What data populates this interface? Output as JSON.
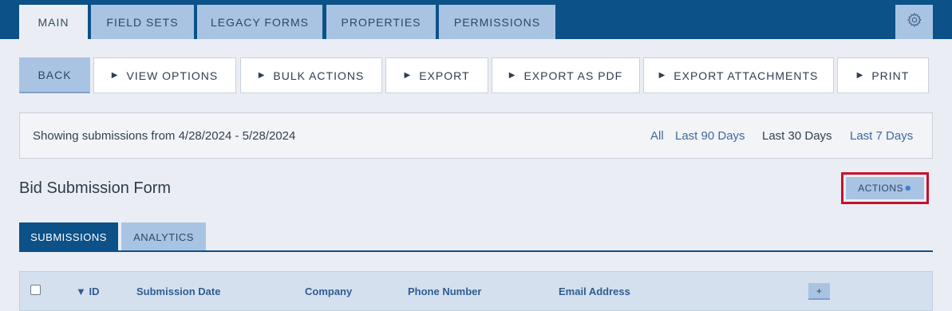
{
  "top_tabs": [
    {
      "label": "MAIN",
      "active": true
    },
    {
      "label": "FIELD SETS",
      "active": false
    },
    {
      "label": "LEGACY FORMS",
      "active": false
    },
    {
      "label": "PROPERTIES",
      "active": false
    },
    {
      "label": "PERMISSIONS",
      "active": false
    }
  ],
  "settings_icon": "gear-icon",
  "toolbar": {
    "back": "BACK",
    "view_options": "VIEW OPTIONS",
    "bulk_actions": "BULK ACTIONS",
    "export": "EXPORT",
    "export_pdf": "EXPORT AS PDF",
    "export_attachments": "EXPORT ATTACHMENTS",
    "print": "PRINT",
    "expand_icon": "triangle-right-icon"
  },
  "filter": {
    "text": "Showing submissions from 4/28/2024 - 5/28/2024",
    "ranges": [
      {
        "label": "All",
        "selected": false
      },
      {
        "label": "Last 90 Days",
        "selected": false
      },
      {
        "label": "Last 30 Days",
        "selected": true
      },
      {
        "label": "Last 7 Days",
        "selected": false
      }
    ]
  },
  "form": {
    "title": "Bid Submission Form",
    "actions_label": "ACTIONS",
    "actions_icon": "gear-icon"
  },
  "sub_tabs": [
    {
      "label": "SUBMISSIONS",
      "active": true
    },
    {
      "label": "ANALYTICS",
      "active": false
    }
  ],
  "table": {
    "columns": [
      "▼ ID",
      "Submission Date",
      "Company",
      "Phone Number",
      "Email Address"
    ],
    "add_column_label": "+"
  },
  "colors": {
    "brand": "#0c5188",
    "tab": "#a9c4e3",
    "highlight": "#c8102e",
    "link": "#3f6a9c"
  }
}
